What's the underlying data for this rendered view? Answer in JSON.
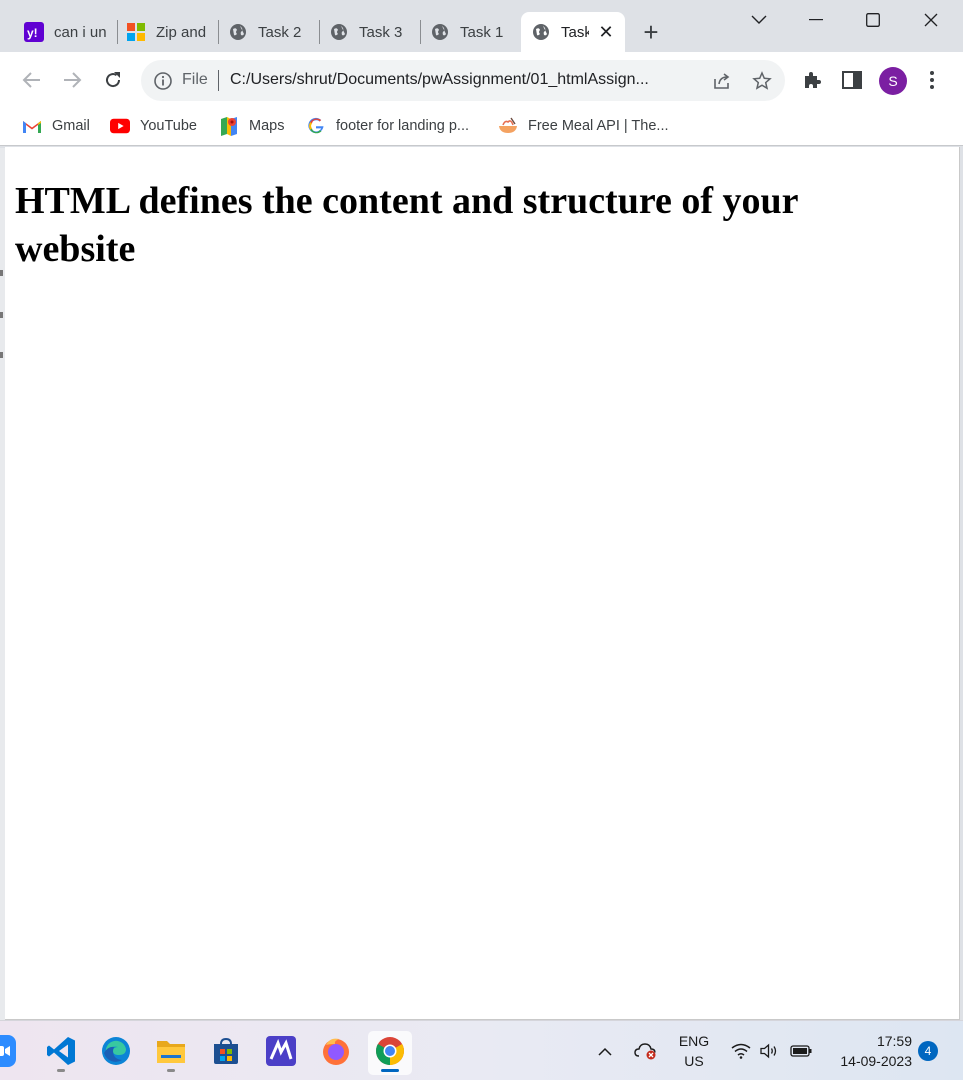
{
  "browser": {
    "tabs": [
      {
        "label": "can i un",
        "icon": "yahoo-icon"
      },
      {
        "label": "Zip and",
        "icon": "microsoft-icon"
      },
      {
        "label": "Task 2",
        "icon": "globe-icon"
      },
      {
        "label": "Task 3",
        "icon": "globe-icon"
      },
      {
        "label": "Task 1",
        "icon": "globe-icon"
      },
      {
        "label": "Task",
        "icon": "globe-icon",
        "active": true
      }
    ],
    "new_tab": "+",
    "omnibox": {
      "scheme_label": "File",
      "url": "C:/Users/shrut/Documents/pwAssignment/01_htmlAssign..."
    },
    "profile_initial": "S",
    "accent_color": "#7b1fa2"
  },
  "bookmarks": [
    {
      "label": "Gmail",
      "icon": "gmail-icon"
    },
    {
      "label": "YouTube",
      "icon": "youtube-icon"
    },
    {
      "label": "Maps",
      "icon": "maps-icon"
    },
    {
      "label": "footer for landing p...",
      "icon": "google-icon"
    },
    {
      "label": "Free Meal API | The...",
      "icon": "meal-icon"
    }
  ],
  "page": {
    "heading": "HTML defines the content and structure of your website"
  },
  "taskbar": {
    "apps": [
      "zoom-icon",
      "vscode-icon",
      "edge-icon",
      "file-explorer-icon",
      "store-icon",
      "maze-app-icon",
      "firefox-icon",
      "chrome-icon"
    ],
    "language_line1": "ENG",
    "language_line2": "US",
    "time": "17:59",
    "date": "14-09-2023",
    "notification_count": "4"
  }
}
